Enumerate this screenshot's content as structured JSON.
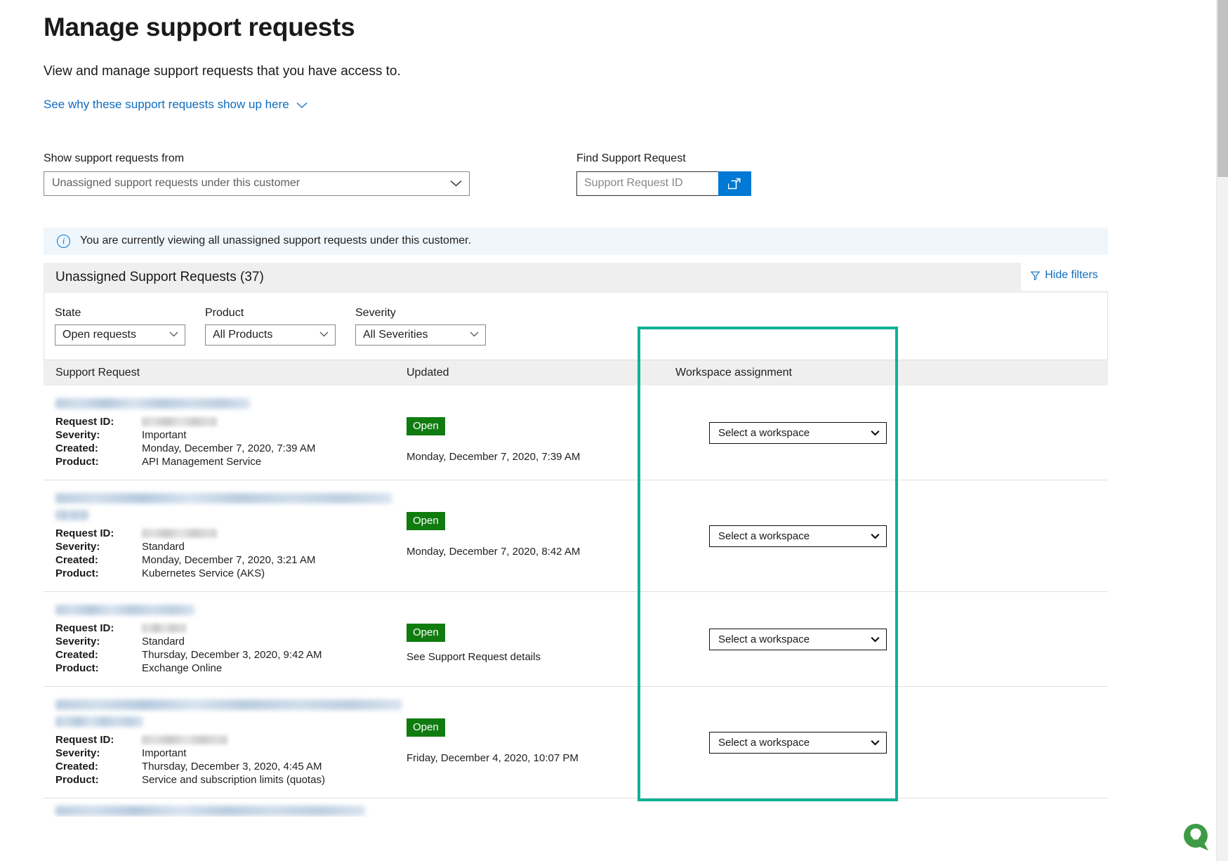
{
  "header": {
    "title": "Manage support requests",
    "subtitle": "View and manage support requests that you have access to.",
    "why_link": "See why these support requests show up here"
  },
  "controls": {
    "show_from_label": "Show support requests from",
    "show_from_value": "Unassigned support requests under this customer",
    "find_label": "Find Support Request",
    "find_placeholder": "Support Request ID",
    "find_value": "",
    "find_button_icon": "open-in-new-window-icon"
  },
  "infobar": {
    "icon": "info-icon",
    "text": "You are currently viewing all unassigned support requests under this customer."
  },
  "panel": {
    "title": "Unassigned Support Requests (37)",
    "hide_filters_label": "Hide filters",
    "hide_filters_icon": "funnel-icon",
    "filters": [
      {
        "label": "State",
        "value": "Open requests"
      },
      {
        "label": "Product",
        "value": "All Products"
      },
      {
        "label": "Severity",
        "value": "All Severities"
      }
    ]
  },
  "table": {
    "columns": {
      "support_request": "Support Request",
      "updated": "Updated",
      "workspace_assignment": "Workspace assignment"
    },
    "labels": {
      "request_id": "Request ID:",
      "severity": "Severity:",
      "created": "Created:",
      "product": "Product:"
    },
    "workspace_placeholder": "Select a workspace",
    "rows": [
      {
        "title_redacted": true,
        "title_lines": 1,
        "title_width": 277,
        "request_id_redacted": true,
        "request_id_width": 107,
        "severity": "Important",
        "created": "Monday, December 7, 2020, 7:39 AM",
        "product": "API Management Service",
        "state_badge": "Open",
        "updated": "Monday, December 7, 2020, 7:39 AM",
        "updated_is_link": false,
        "workspace_value": "Select a workspace"
      },
      {
        "title_redacted": true,
        "title_lines": 2,
        "title_width": 479,
        "title_width2": 48,
        "request_id_redacted": true,
        "request_id_width": 107,
        "severity": "Standard",
        "created": "Monday, December 7, 2020, 3:21 AM",
        "product": "Kubernetes Service (AKS)",
        "state_badge": "Open",
        "updated": "Monday, December 7, 2020, 8:42 AM",
        "updated_is_link": false,
        "workspace_value": "Select a workspace"
      },
      {
        "title_redacted": true,
        "title_lines": 1,
        "title_width": 198,
        "request_id_redacted": true,
        "request_id_width": 63,
        "severity": "Standard",
        "created": "Thursday, December 3, 2020, 9:42 AM",
        "product": "Exchange Online",
        "state_badge": "Open",
        "updated": "See Support Request details",
        "updated_is_link": true,
        "workspace_value": "Select a workspace"
      },
      {
        "title_redacted": true,
        "title_lines": 2,
        "title_width": 494,
        "title_width2": 125,
        "request_id_redacted": true,
        "request_id_width": 122,
        "severity": "Important",
        "created": "Thursday, December 3, 2020, 4:45 AM",
        "product": "Service and subscription limits (quotas)",
        "state_badge": "Open",
        "updated": "Friday, December 4, 2020, 10:07 PM",
        "updated_is_link": false,
        "workspace_value": "Select a workspace"
      },
      {
        "title_redacted": true,
        "title_lines": 1,
        "title_width": 441,
        "partial": true
      }
    ]
  },
  "feedback_widget": {
    "icon": "feedback-lightbulb-icon"
  },
  "colors": {
    "accent_blue": "#0078d4",
    "link_blue": "#0f6cbd",
    "open_green": "#107c10",
    "highlight_teal": "#10b197",
    "info_bg": "#eff6fc",
    "panel_head_bg": "#efefef",
    "feedback_green": "#3e9a45"
  },
  "highlight": {
    "name": "workspace-assignment-highlight"
  }
}
